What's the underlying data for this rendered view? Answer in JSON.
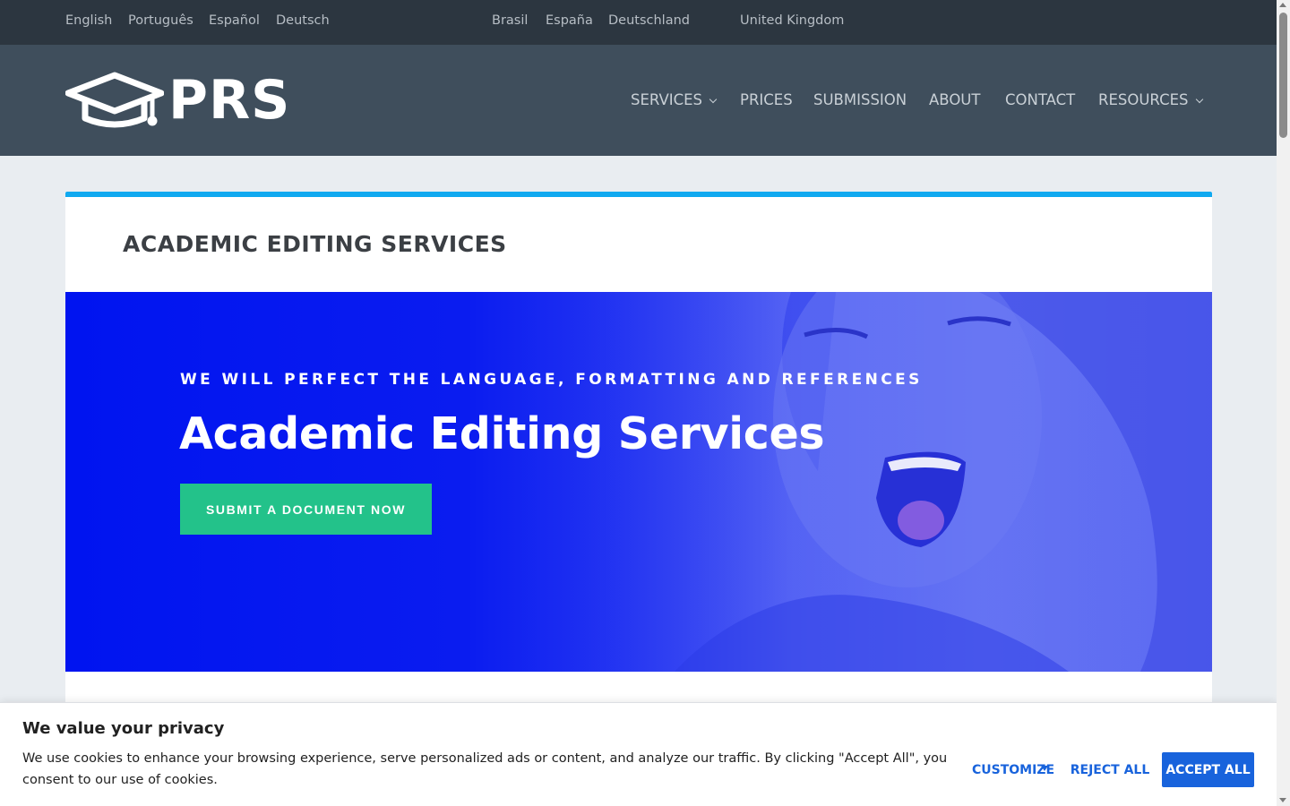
{
  "language_bar": {
    "languages": [
      "English",
      "Português",
      "Español",
      "Deutsch"
    ],
    "countries": [
      "Brasil",
      "España",
      "Deutschland",
      "United Kingdom"
    ]
  },
  "header": {
    "logo_text": "PRS",
    "nav": [
      {
        "label": "SERVICES",
        "has_dropdown": true
      },
      {
        "label": "PRICES",
        "has_dropdown": false
      },
      {
        "label": "SUBMISSION",
        "has_dropdown": false
      },
      {
        "label": "ABOUT",
        "has_dropdown": false
      },
      {
        "label": "CONTACT",
        "has_dropdown": false
      },
      {
        "label": "RESOURCES",
        "has_dropdown": true
      }
    ]
  },
  "page": {
    "title": "ACADEMIC EDITING SERVICES"
  },
  "hero": {
    "subtitle": "WE WILL PERFECT THE LANGUAGE, FORMATTING AND REFERENCES",
    "title": "Academic Editing Services",
    "cta_label": "SUBMIT A DOCUMENT NOW"
  },
  "cookie_banner": {
    "title": "We value your privacy",
    "text": "We use cookies to enhance your browsing experience, serve personalized ads or content, and analyze our traffic. By clicking \"Accept All\", you consent to our use of cookies.",
    "customize_label": "CUSTOMIZE",
    "reject_label": "REJECT ALL",
    "accept_label": "ACCEPT ALL"
  },
  "colors": {
    "topbar_bg": "#2c3640",
    "header_bg": "#3f4e5c",
    "accent_bar": "#10a9f0",
    "hero_blue": "#0014f0",
    "cta_green": "#23c28a",
    "cookie_blue": "#1863dc"
  },
  "icons": {
    "logo": "graduation-cap-icon",
    "dropdown": "chevron-down-icon"
  }
}
